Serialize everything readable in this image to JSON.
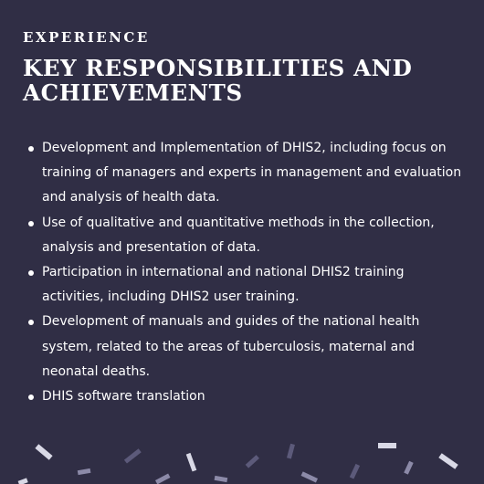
{
  "header": {
    "eyebrow": "EXPERIENCE",
    "title": "KEY RESPONSIBILITIES AND ACHIEVEMENTS"
  },
  "responsibilities": [
    "Development and Implementation of DHIS2, including focus on training of managers and experts in management and evaluation and analysis of health data.",
    "Use of qualitative and quantitative methods in the collection, analysis and presentation of data.",
    "Participation in international and national DHIS2 training activities, including DHIS2 user training.",
    "Development of manuals and guides of the national health system, related to the areas of tuberculosis, maternal and neonatal deaths.",
    "DHIS software translation"
  ],
  "colors": {
    "background": "#302e45",
    "text": "#ffffff",
    "confetti_light": "#d9d9e6",
    "confetti_mid": "#8c8aa8",
    "confetti_dark": "#5c5a7a"
  }
}
